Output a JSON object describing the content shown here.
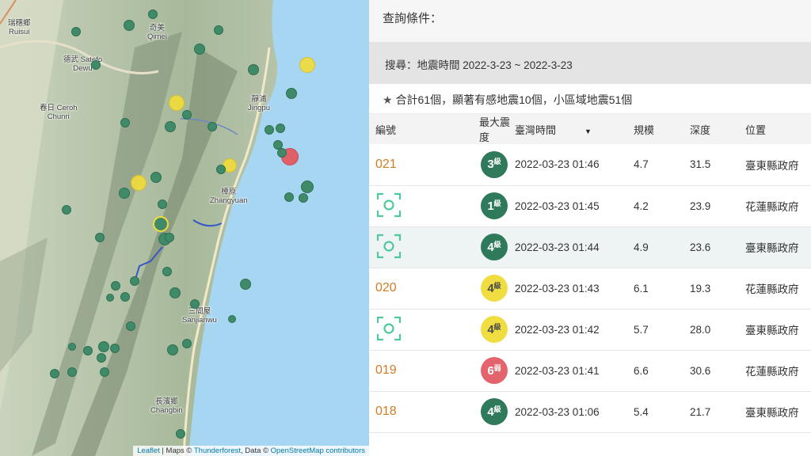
{
  "map": {
    "place_labels": [
      {
        "zh": "瑞穗鄉",
        "en": "Ruisui"
      },
      {
        "zh": "奇美",
        "en": "Qimei"
      },
      {
        "zh": "德武 Satefo",
        "en": "Dewu"
      },
      {
        "zh": "春日 Ceroh",
        "en": "Chunri"
      },
      {
        "zh": "靜浦",
        "en": "Jingpu"
      },
      {
        "zh": "樟原",
        "en": "Zhangyuan"
      },
      {
        "zh": "三間屋",
        "en": "Sanjianwu"
      },
      {
        "zh": "長濱鄉",
        "en": "Changbin"
      }
    ],
    "attribution": {
      "leaflet": "Leaflet",
      "maps_prefix": " | Maps © ",
      "thunderforest": "Thunderforest",
      "data_prefix": ", Data © ",
      "osm": "OpenStreetMap contributors"
    }
  },
  "panel": {
    "query_title": "查詢條件：",
    "search_text": "搜尋：地震時間 2022-3-23 ~ 2022-3-23",
    "summary_text": "合計61個，顯著有感地震10個，小區域地震51個",
    "columns": [
      "編號",
      "最大震度",
      "臺灣時間",
      "規模",
      "深度",
      "位置"
    ],
    "rows": [
      {
        "id": "021",
        "icon": "",
        "intensity_num": "3",
        "intensity_unit": "級",
        "intensity_color": "green",
        "time": "2022-03-23 01:46",
        "magnitude": "4.7",
        "depth": "31.5",
        "location": "臺東縣政府"
      },
      {
        "id": "",
        "icon": "scan-icon",
        "intensity_num": "1",
        "intensity_unit": "級",
        "intensity_color": "green",
        "time": "2022-03-23 01:45",
        "magnitude": "4.2",
        "depth": "23.9",
        "location": "花蓮縣政府"
      },
      {
        "id": "",
        "icon": "scan-icon",
        "intensity_num": "4",
        "intensity_unit": "級",
        "intensity_color": "green",
        "time": "2022-03-23 01:44",
        "magnitude": "4.9",
        "depth": "23.6",
        "location": "臺東縣政府"
      },
      {
        "id": "020",
        "icon": "",
        "intensity_num": "4",
        "intensity_unit": "級",
        "intensity_color": "yellow",
        "time": "2022-03-23 01:43",
        "magnitude": "6.1",
        "depth": "19.3",
        "location": "花蓮縣政府"
      },
      {
        "id": "",
        "icon": "scan-icon",
        "intensity_num": "4",
        "intensity_unit": "級",
        "intensity_color": "yellow",
        "time": "2022-03-23 01:42",
        "magnitude": "5.7",
        "depth": "28.0",
        "location": "臺東縣政府"
      },
      {
        "id": "019",
        "icon": "",
        "intensity_num": "6",
        "intensity_unit": "弱",
        "intensity_color": "red",
        "time": "2022-03-23 01:41",
        "magnitude": "6.6",
        "depth": "30.6",
        "location": "花蓮縣政府"
      },
      {
        "id": "018",
        "icon": "",
        "intensity_num": "4",
        "intensity_unit": "級",
        "intensity_color": "green",
        "time": "2022-03-23 01:06",
        "magnitude": "5.4",
        "depth": "21.7",
        "location": "臺東縣政府"
      }
    ]
  },
  "colors": {
    "green": "#2f7a5a",
    "yellow": "#f0dd42",
    "red": "#e3646c",
    "sea": "#a6d6f2",
    "id_orange": "#d07c24"
  }
}
